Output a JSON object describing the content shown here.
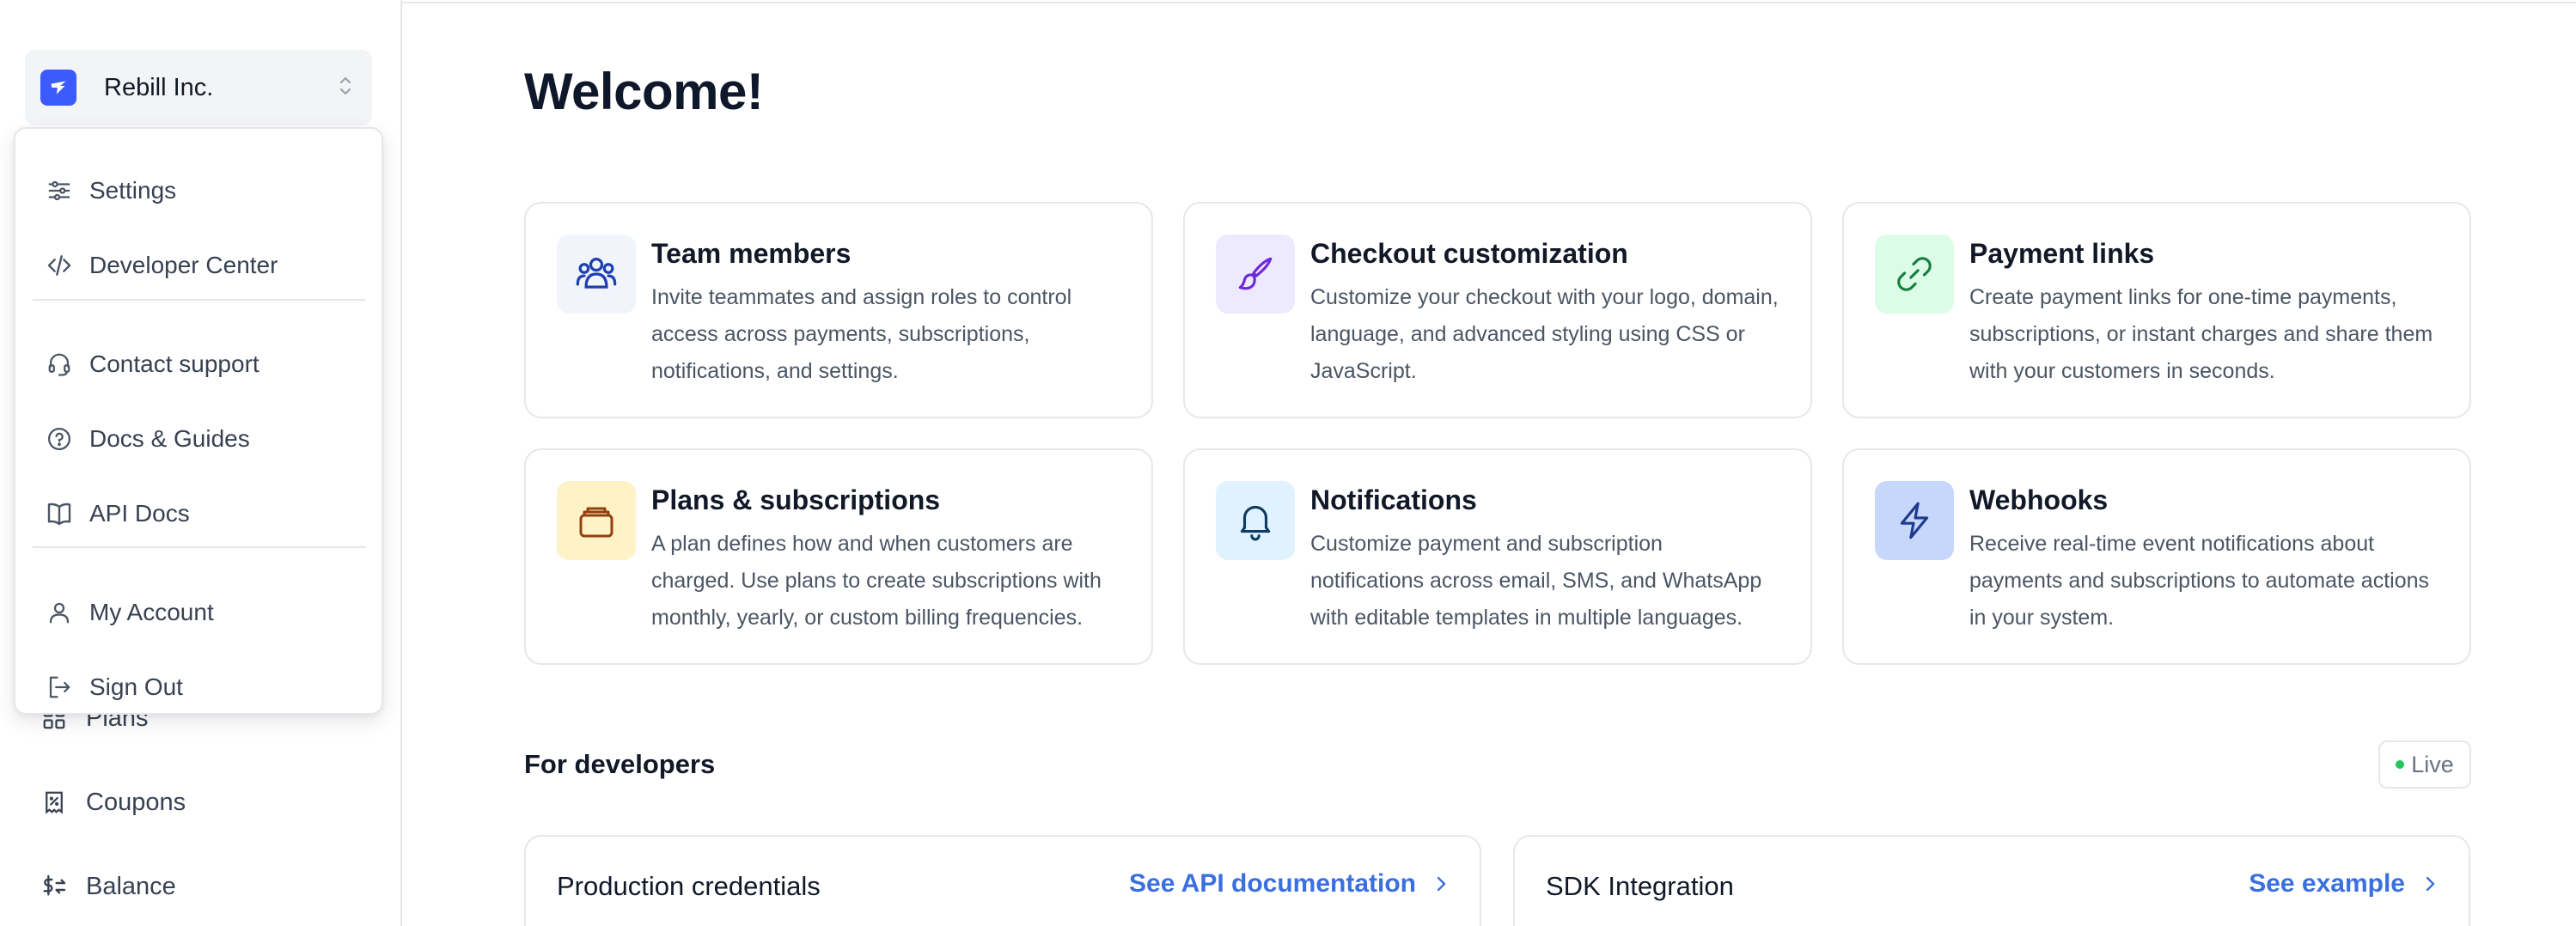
{
  "org": {
    "name": "Rebill Inc."
  },
  "sidebar": {
    "items": [
      {
        "label": "Plans",
        "icon": "grid-icon"
      },
      {
        "label": "Coupons",
        "icon": "coupon-icon"
      },
      {
        "label": "Balance",
        "icon": "dollar-exchange-icon"
      }
    ]
  },
  "dropdown": {
    "items": [
      {
        "label": "Settings",
        "icon": "sliders-icon"
      },
      {
        "label": "Developer Center",
        "icon": "code-icon"
      },
      {
        "label": "Contact support",
        "icon": "headset-icon"
      },
      {
        "label": "Docs & Guides",
        "icon": "help-circle-icon"
      },
      {
        "label": "API Docs",
        "icon": "book-icon"
      },
      {
        "label": "My Account",
        "icon": "user-icon"
      },
      {
        "label": "Sign Out",
        "icon": "sign-out-icon"
      }
    ]
  },
  "main": {
    "welcome": "Welcome!",
    "cards": [
      {
        "title": "Team members",
        "icon": "users-icon",
        "color": "#f1f5fb",
        "lines": [
          "Invite teammates and assign roles to control",
          "access across payments, subscriptions,",
          "notifications, and settings."
        ]
      },
      {
        "title": "Checkout customization",
        "icon": "brush-icon",
        "color": "#ede9fe",
        "lines": [
          "Customize your checkout with your logo, domain,",
          "language, and advanced styling using CSS or",
          "JavaScript."
        ]
      },
      {
        "title": "Payment links",
        "icon": "link-icon",
        "color": "#dcfce7",
        "lines": [
          "Create payment links for one-time payments,",
          "subscriptions, or instant charges and share them",
          "with your customers in seconds."
        ]
      },
      {
        "title": "Plans & subscriptions",
        "icon": "stack-icon",
        "color": "#fef3c7",
        "lines": [
          "A plan defines how and when customers are",
          "charged. Use plans to create subscriptions with",
          "monthly, yearly, or custom billing frequencies."
        ]
      },
      {
        "title": "Notifications",
        "icon": "bell-icon",
        "color": "#e0f2fe",
        "lines": [
          "Customize payment and subscription",
          "notifications across email, SMS, and WhatsApp",
          "with editable templates in multiple languages."
        ]
      },
      {
        "title": "Webhooks",
        "icon": "lightning-icon",
        "color": "#c7d7fb",
        "lines": [
          "Receive real-time event notifications about",
          "payments and subscriptions to automate actions",
          "in your system."
        ]
      }
    ],
    "developers": {
      "title": "For developers",
      "badge": "Live",
      "cards": [
        {
          "title": "Production credentials",
          "link": "See API documentation"
        },
        {
          "title": "SDK Integration",
          "link": "See example"
        }
      ]
    }
  }
}
